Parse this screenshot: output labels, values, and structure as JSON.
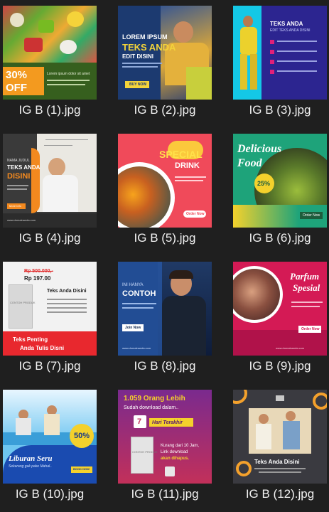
{
  "files": [
    {
      "name": "IG B (1).jpg",
      "lines": [
        "30%",
        "OFF",
        "Lorem ipsum dolor sit amet"
      ]
    },
    {
      "name": "IG B (2).jpg",
      "lines": [
        "LOREM IPSUM",
        "TEKS ANDA",
        "EDIT DISINI",
        "BUY NOW"
      ]
    },
    {
      "name": "IG B (3).jpg",
      "lines": [
        "TEKS ANDA",
        "EDIT TEKS ANDA DISINI"
      ]
    },
    {
      "name": "IG B (4).jpg",
      "lines": [
        "NAMA JUDUL",
        "TEKS ANDA",
        "DISINI",
        "More Info",
        "www.domainanda.com"
      ]
    },
    {
      "name": "IG B (5).jpg",
      "lines": [
        "SPECIAL",
        "DRINK",
        "Order Now"
      ]
    },
    {
      "name": "IG B (6).jpg",
      "lines": [
        "Delicious",
        "Food",
        "25%",
        "Order Now"
      ]
    },
    {
      "name": "IG B (7).jpg",
      "lines": [
        "Rp 500.000,-",
        "Rp 197.00",
        "Teks Anda Disini",
        "CONTOH PRODUK",
        "Teks Penting",
        "Anda Tulis Disni"
      ]
    },
    {
      "name": "IG B (8).jpg",
      "lines": [
        "INI HANYA",
        "CONTOH",
        "Join Now",
        "www.domainanda.com"
      ]
    },
    {
      "name": "IG B (9).jpg",
      "lines": [
        "Parfum",
        "Spesial",
        "Order Now",
        "www.domainanda.com"
      ]
    },
    {
      "name": "IG B (10).jpg",
      "lines": [
        "Liburan Seru",
        "Sekarang gak pake Mahal..",
        "50%",
        "BOOK NOW"
      ]
    },
    {
      "name": "IG B (11).jpg",
      "lines": [
        "1.059 Orang Lebih",
        "Sudah download dalam..",
        "7",
        "Hari Terakhir",
        "CONTOH PRODUK",
        "Kurang dari 10 Jam,",
        "Link download",
        "akan dihapus."
      ]
    },
    {
      "name": "IG B (12).jpg",
      "lines": [
        "Teks Anda Disini"
      ]
    }
  ]
}
